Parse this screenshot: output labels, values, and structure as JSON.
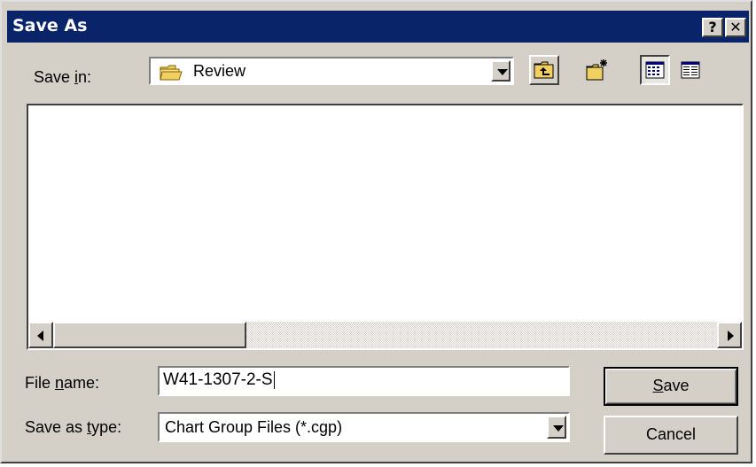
{
  "dialog": {
    "title": "Save As",
    "help_button": "?",
    "close_button": "✕"
  },
  "toolbar": {
    "save_in_label_pre": "Save ",
    "save_in_label_key": "i",
    "save_in_label_post": "n:",
    "save_in_value": "Review",
    "icons": [
      "folder-icon",
      "up-one-level-icon",
      "create-new-folder-icon",
      "list-view-icon",
      "details-view-icon"
    ]
  },
  "file_list": {
    "items": []
  },
  "filename": {
    "label_pre": "File ",
    "label_key": "n",
    "label_post": "ame:",
    "value": "W41-1307-2-S"
  },
  "filetype": {
    "label_pre": "Save as ",
    "label_key": "t",
    "label_post": "ype:",
    "value": "Chart Group Files (*.cgp)"
  },
  "buttons": {
    "save_key": "S",
    "save_rest": "ave",
    "cancel": "Cancel"
  },
  "colors": {
    "titlebar": "#0a246a",
    "face": "#d4d0c8",
    "folder": "#f0d060"
  }
}
